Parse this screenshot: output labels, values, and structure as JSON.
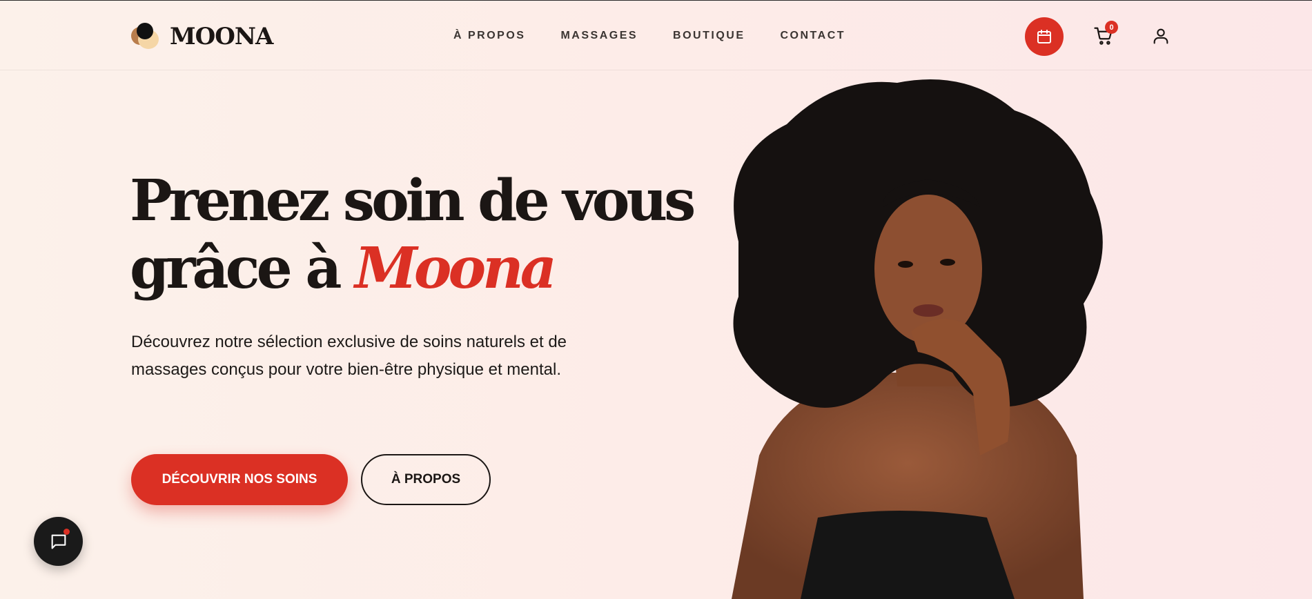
{
  "brand": {
    "name": "MOONA"
  },
  "nav": {
    "items": [
      "À PROPOS",
      "MASSAGES",
      "BOUTIQUE",
      "CONTACT"
    ]
  },
  "header_actions": {
    "calendar_icon": "calendar-icon",
    "cart_icon": "cart-icon",
    "cart_count": "0",
    "user_icon": "user-icon"
  },
  "hero": {
    "title_line1": "Prenez soin de vous",
    "title_line2_prefix": "grâce à ",
    "title_line2_accent": "Moona",
    "description": "Découvrez notre sélection exclusive de soins naturels et de massages conçus pour votre bien-être physique et mental.",
    "primary_cta": "DÉCOUVRIR NOS SOINS",
    "secondary_cta": "À PROPOS"
  },
  "chat": {
    "icon": "chat-icon"
  },
  "colors": {
    "accent": "#db3024",
    "text": "#1b1614",
    "background_start": "#fcf1ea",
    "background_end": "#fce7e8"
  }
}
